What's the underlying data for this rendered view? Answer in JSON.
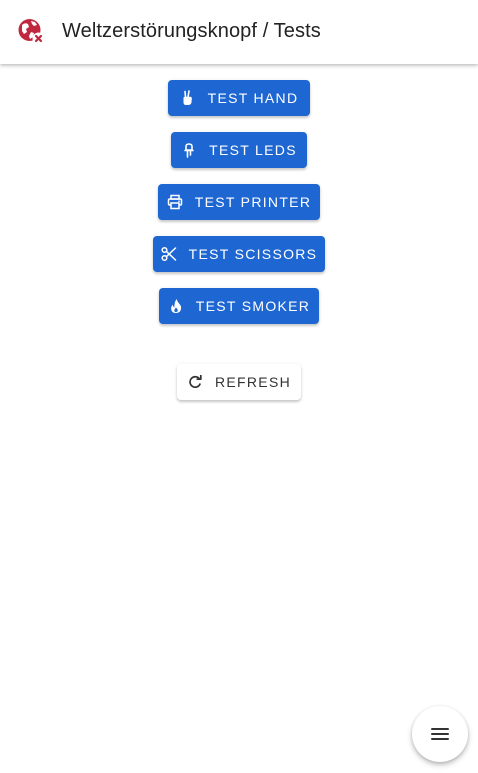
{
  "header": {
    "title": "Weltzerstörungsknopf / Tests",
    "logo_icon": "globe-cancel-icon"
  },
  "tests": [
    {
      "label": "TEST HAND",
      "icon": "hand-peace-icon"
    },
    {
      "label": "TEST LEDS",
      "icon": "led-icon"
    },
    {
      "label": "TEST PRINTER",
      "icon": "printer-icon"
    },
    {
      "label": "TEST SCISSORS",
      "icon": "scissors-icon"
    },
    {
      "label": "TEST SMOKER",
      "icon": "fire-icon"
    }
  ],
  "refresh": {
    "label": "REFRESH",
    "icon": "refresh-icon"
  },
  "fab": {
    "icon": "menu-icon"
  },
  "colors": {
    "primary": "#1e67d3",
    "logo": "#c0283f",
    "background": "#ffffff"
  }
}
